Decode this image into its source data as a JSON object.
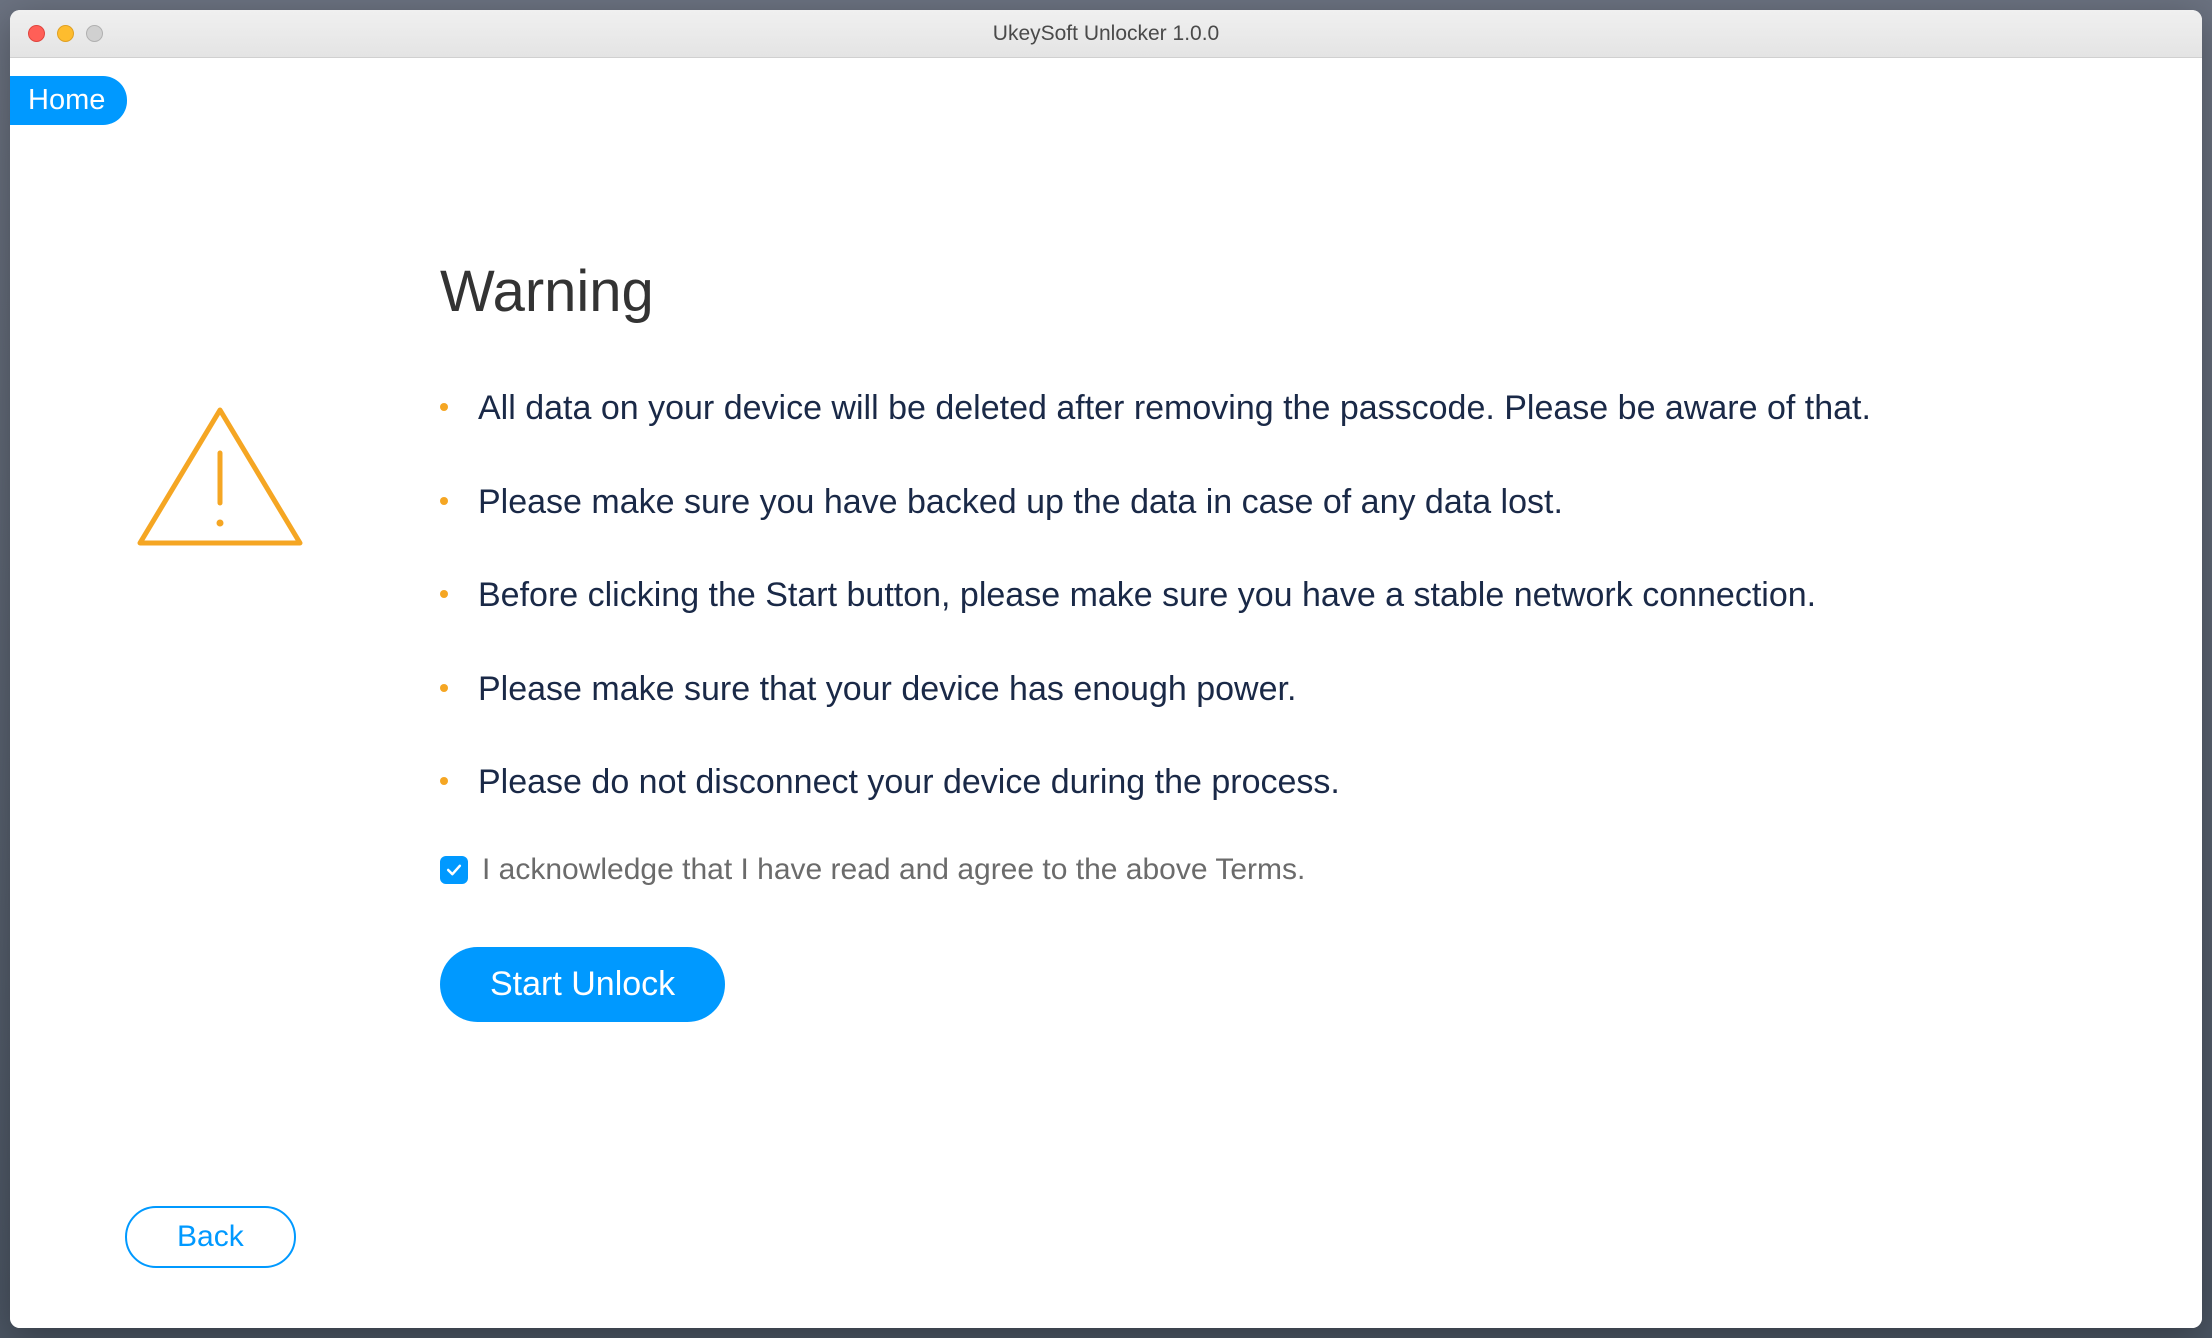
{
  "window": {
    "title": "UkeySoft Unlocker 1.0.0"
  },
  "nav": {
    "home_label": "Home"
  },
  "main": {
    "heading": "Warning",
    "bullets": [
      "All data on your device will be deleted after removing the passcode. Please be aware of that.",
      "Please make sure you have backed up the data in case of any data lost.",
      "Before clicking the Start button, please make sure you have a stable network connection.",
      "Please make sure that your device has enough power.",
      "Please do not disconnect your device during the process."
    ],
    "ack_label": "I acknowledge that I have read and agree to the above Terms.",
    "ack_checked": true,
    "start_label": "Start Unlock",
    "back_label": "Back"
  },
  "colors": {
    "accent": "#0099ff",
    "warning": "#f5a623",
    "text_dark": "#1a2947"
  }
}
